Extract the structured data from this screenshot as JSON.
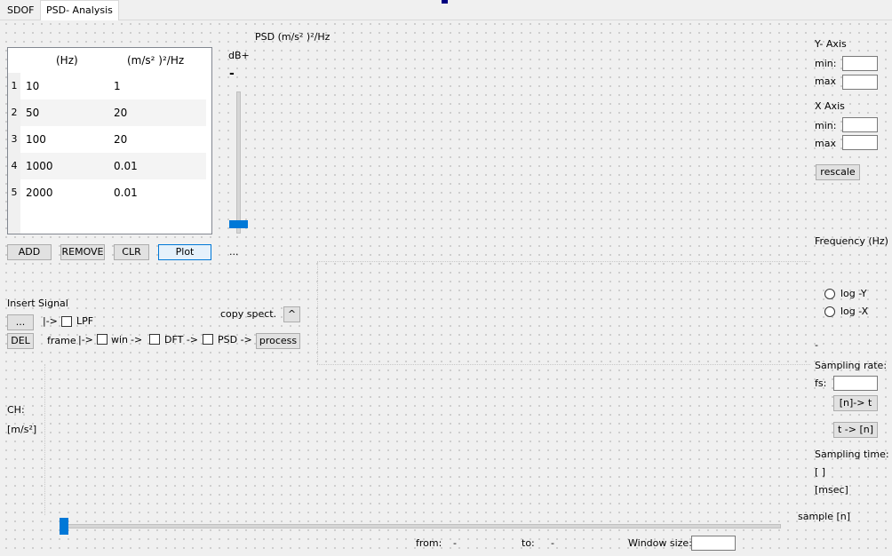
{
  "tabs": [
    {
      "label": "SDOF"
    },
    {
      "label": "PSD- Analysis"
    }
  ],
  "table": {
    "col_hz": "(Hz)",
    "col_psd": "(m/s² )²/Hz",
    "rows": [
      {
        "n": "1",
        "hz": "10",
        "psd": "1"
      },
      {
        "n": "2",
        "hz": "50",
        "psd": "20"
      },
      {
        "n": "3",
        "hz": "100",
        "psd": "20"
      },
      {
        "n": "4",
        "hz": "1000",
        "psd": "0.01"
      },
      {
        "n": "5",
        "hz": "2000",
        "psd": "0.01"
      }
    ]
  },
  "buttons": {
    "add": "ADD",
    "remove": "REMOVE",
    "clr": "CLR",
    "plot": "Plot",
    "browse": "...",
    "del": "DEL",
    "process": "process",
    "rescale": "rescale",
    "n_to_t": "[n]-> t",
    "t_to_n": "t -> [n]",
    "copy_up": "^"
  },
  "db_slider": {
    "plus": "dB+",
    "minus": "-",
    "dots": "...",
    "level": 0.03
  },
  "plot": {
    "ylabel": "PSD (m/s² )²/Hz",
    "xlabel": "Frequency (Hz)"
  },
  "axis": {
    "y_title": "Y- Axis",
    "x_title": "X Axis",
    "min": "min:",
    "max": "max"
  },
  "log": {
    "y": "log -Y",
    "x": "log -X"
  },
  "signal": {
    "insert": "Insert Signal",
    "arrow1": "|->",
    "lpf": "LPF",
    "copy": "copy spect.",
    "frame": "frame",
    "arrow2": "|->",
    "win": "win",
    "arrow3": "->",
    "dft": "DFT ->",
    "psd": "PSD ->"
  },
  "channel": {
    "ch": "CH:",
    "unit": "[m/s²]"
  },
  "sampling": {
    "dash": "-",
    "rate": "Sampling rate:",
    "fs": "fs:",
    "time": "Sampling time:",
    "brackets": "[ ]",
    "msec": "[msec]"
  },
  "bottom": {
    "sample": "sample [n]",
    "from": "from:",
    "from_val": "-",
    "to": "to:",
    "to_val": "-",
    "window": "Window size:",
    "slider_pos": 0.0
  },
  "colors": {
    "accent": "#0078d7"
  }
}
